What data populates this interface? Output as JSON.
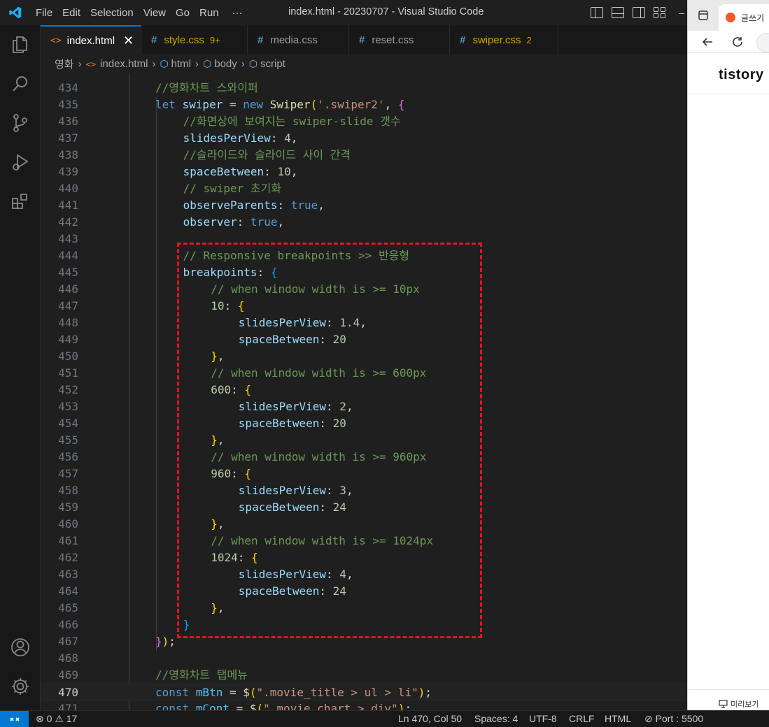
{
  "window": {
    "title": "index.html - 20230707 - Visual Studio Code"
  },
  "menu": [
    "File",
    "Edit",
    "Selection",
    "View",
    "Go",
    "Run",
    "···"
  ],
  "tabs": [
    {
      "label": "index.html",
      "type": "html",
      "active": true,
      "badge": ""
    },
    {
      "label": "style.css",
      "type": "css",
      "active": false,
      "badge": "9+"
    },
    {
      "label": "media.css",
      "type": "css",
      "active": false,
      "badge": ""
    },
    {
      "label": "reset.css",
      "type": "css",
      "active": false,
      "badge": ""
    },
    {
      "label": "swiper.css",
      "type": "css",
      "active": false,
      "badge": "2"
    }
  ],
  "breadcrumb": [
    "영화",
    "index.html",
    "html",
    "body",
    "script"
  ],
  "editor": {
    "current_line": "470",
    "lines": [
      {
        "n": "434",
        "indent": 3,
        "tokens": [
          [
            "c-com",
            "//영화차트 스와이퍼"
          ]
        ]
      },
      {
        "n": "435",
        "indent": 3,
        "tokens": [
          [
            "c-kw",
            "let "
          ],
          [
            "c-var",
            "swiper"
          ],
          [
            "c-txt",
            " = "
          ],
          [
            "c-kw",
            "new "
          ],
          [
            "c-fn",
            "Swiper"
          ],
          [
            "c-b1",
            "("
          ],
          [
            "c-str",
            "'.swiper2'"
          ],
          [
            "c-txt",
            ", "
          ],
          [
            "c-b2",
            "{"
          ]
        ]
      },
      {
        "n": "436",
        "indent": 4,
        "tokens": [
          [
            "c-com",
            "//화면상에 보여지는 swiper-slide 갯수"
          ]
        ]
      },
      {
        "n": "437",
        "indent": 4,
        "tokens": [
          [
            "c-var",
            "slidesPerView"
          ],
          [
            "c-txt",
            ": "
          ],
          [
            "c-num",
            "4"
          ],
          [
            "c-txt",
            ","
          ]
        ]
      },
      {
        "n": "438",
        "indent": 4,
        "tokens": [
          [
            "c-com",
            "//슬라이드와 슬라이드 사이 간격"
          ]
        ]
      },
      {
        "n": "439",
        "indent": 4,
        "tokens": [
          [
            "c-var",
            "spaceBetween"
          ],
          [
            "c-txt",
            ": "
          ],
          [
            "c-num",
            "10"
          ],
          [
            "c-txt",
            ","
          ]
        ]
      },
      {
        "n": "440",
        "indent": 4,
        "tokens": [
          [
            "c-com",
            "// swiper 초기화"
          ]
        ]
      },
      {
        "n": "441",
        "indent": 4,
        "tokens": [
          [
            "c-var",
            "observeParents"
          ],
          [
            "c-txt",
            ": "
          ],
          [
            "c-kw",
            "true"
          ],
          [
            "c-txt",
            ","
          ]
        ]
      },
      {
        "n": "442",
        "indent": 4,
        "tokens": [
          [
            "c-var",
            "observer"
          ],
          [
            "c-txt",
            ": "
          ],
          [
            "c-kw",
            "true"
          ],
          [
            "c-txt",
            ","
          ]
        ]
      },
      {
        "n": "443",
        "indent": 4,
        "tokens": []
      },
      {
        "n": "444",
        "indent": 4,
        "tokens": [
          [
            "c-com",
            "// Responsive breakpoints >> 반응형"
          ]
        ]
      },
      {
        "n": "445",
        "indent": 4,
        "tokens": [
          [
            "c-var",
            "breakpoints"
          ],
          [
            "c-txt",
            ": "
          ],
          [
            "c-b3",
            "{"
          ]
        ]
      },
      {
        "n": "446",
        "indent": 5,
        "tokens": [
          [
            "c-com",
            "// when window width is >= 10px"
          ]
        ]
      },
      {
        "n": "447",
        "indent": 5,
        "tokens": [
          [
            "c-num",
            "10"
          ],
          [
            "c-txt",
            ": "
          ],
          [
            "c-b1",
            "{"
          ]
        ]
      },
      {
        "n": "448",
        "indent": 6,
        "tokens": [
          [
            "c-var",
            "slidesPerView"
          ],
          [
            "c-txt",
            ": "
          ],
          [
            "c-num",
            "1.4"
          ],
          [
            "c-txt",
            ","
          ]
        ]
      },
      {
        "n": "449",
        "indent": 6,
        "tokens": [
          [
            "c-var",
            "spaceBetween"
          ],
          [
            "c-txt",
            ": "
          ],
          [
            "c-num",
            "20"
          ]
        ]
      },
      {
        "n": "450",
        "indent": 5,
        "tokens": [
          [
            "c-b1",
            "}"
          ],
          [
            "c-txt",
            ","
          ]
        ]
      },
      {
        "n": "451",
        "indent": 5,
        "tokens": [
          [
            "c-com",
            "// when window width is >= 600px"
          ]
        ]
      },
      {
        "n": "452",
        "indent": 5,
        "tokens": [
          [
            "c-num",
            "600"
          ],
          [
            "c-txt",
            ": "
          ],
          [
            "c-b1",
            "{"
          ]
        ]
      },
      {
        "n": "453",
        "indent": 6,
        "tokens": [
          [
            "c-var",
            "slidesPerView"
          ],
          [
            "c-txt",
            ": "
          ],
          [
            "c-num",
            "2"
          ],
          [
            "c-txt",
            ","
          ]
        ]
      },
      {
        "n": "454",
        "indent": 6,
        "tokens": [
          [
            "c-var",
            "spaceBetween"
          ],
          [
            "c-txt",
            ": "
          ],
          [
            "c-num",
            "20"
          ]
        ]
      },
      {
        "n": "455",
        "indent": 5,
        "tokens": [
          [
            "c-b1",
            "}"
          ],
          [
            "c-txt",
            ","
          ]
        ]
      },
      {
        "n": "456",
        "indent": 5,
        "tokens": [
          [
            "c-com",
            "// when window width is >= 960px"
          ]
        ]
      },
      {
        "n": "457",
        "indent": 5,
        "tokens": [
          [
            "c-num",
            "960"
          ],
          [
            "c-txt",
            ": "
          ],
          [
            "c-b1",
            "{"
          ]
        ]
      },
      {
        "n": "458",
        "indent": 6,
        "tokens": [
          [
            "c-var",
            "slidesPerView"
          ],
          [
            "c-txt",
            ": "
          ],
          [
            "c-num",
            "3"
          ],
          [
            "c-txt",
            ","
          ]
        ]
      },
      {
        "n": "459",
        "indent": 6,
        "tokens": [
          [
            "c-var",
            "spaceBetween"
          ],
          [
            "c-txt",
            ": "
          ],
          [
            "c-num",
            "24"
          ]
        ]
      },
      {
        "n": "460",
        "indent": 5,
        "tokens": [
          [
            "c-b1",
            "}"
          ],
          [
            "c-txt",
            ","
          ]
        ]
      },
      {
        "n": "461",
        "indent": 5,
        "tokens": [
          [
            "c-com",
            "// when window width is >= 1024px"
          ]
        ]
      },
      {
        "n": "462",
        "indent": 5,
        "tokens": [
          [
            "c-num",
            "1024"
          ],
          [
            "c-txt",
            ": "
          ],
          [
            "c-b1",
            "{"
          ]
        ]
      },
      {
        "n": "463",
        "indent": 6,
        "tokens": [
          [
            "c-var",
            "slidesPerView"
          ],
          [
            "c-txt",
            ": "
          ],
          [
            "c-num",
            "4"
          ],
          [
            "c-txt",
            ","
          ]
        ]
      },
      {
        "n": "464",
        "indent": 6,
        "tokens": [
          [
            "c-var",
            "spaceBetween"
          ],
          [
            "c-txt",
            ": "
          ],
          [
            "c-num",
            "24"
          ]
        ]
      },
      {
        "n": "465",
        "indent": 5,
        "tokens": [
          [
            "c-b1",
            "}"
          ],
          [
            "c-txt",
            ","
          ]
        ]
      },
      {
        "n": "466",
        "indent": 4,
        "tokens": [
          [
            "c-b3",
            "}"
          ]
        ]
      },
      {
        "n": "467",
        "indent": 3,
        "tokens": [
          [
            "c-b2",
            "}"
          ],
          [
            "c-b1",
            ")"
          ],
          [
            "c-txt",
            ";"
          ]
        ]
      },
      {
        "n": "468",
        "indent": 3,
        "tokens": []
      },
      {
        "n": "469",
        "indent": 3,
        "tokens": [
          [
            "c-com",
            "//영화차트 탭메뉴"
          ]
        ]
      },
      {
        "n": "470",
        "indent": 3,
        "tokens": [
          [
            "c-kw",
            "const "
          ],
          [
            "c-const",
            "mBtn"
          ],
          [
            "c-txt",
            " = "
          ],
          [
            "c-fn",
            "$"
          ],
          [
            "c-b1",
            "("
          ],
          [
            "c-str",
            "\".movie_title > ul > li\""
          ],
          [
            "c-b1",
            ")"
          ],
          [
            "c-txt",
            ";"
          ]
        ]
      },
      {
        "n": "471",
        "indent": 3,
        "tokens": [
          [
            "c-kw",
            "const "
          ],
          [
            "c-const",
            "mCont"
          ],
          [
            "c-txt",
            " = "
          ],
          [
            "c-fn",
            "$"
          ],
          [
            "c-b1",
            "("
          ],
          [
            "c-str",
            "\".movie_chart > div\""
          ],
          [
            "c-b1",
            ")"
          ],
          [
            "c-txt",
            ";"
          ]
        ]
      }
    ]
  },
  "browser": {
    "tab_title": "글쓰기",
    "logo": "tistory",
    "preview_label": "미리보기"
  },
  "status": {
    "errors": "0",
    "warnings": "17",
    "position": "Ln 470, Col 50",
    "spaces": "Spaces: 4",
    "encoding": "UTF-8",
    "eol": "CRLF",
    "language": "HTML",
    "port": "Port : 5500"
  }
}
